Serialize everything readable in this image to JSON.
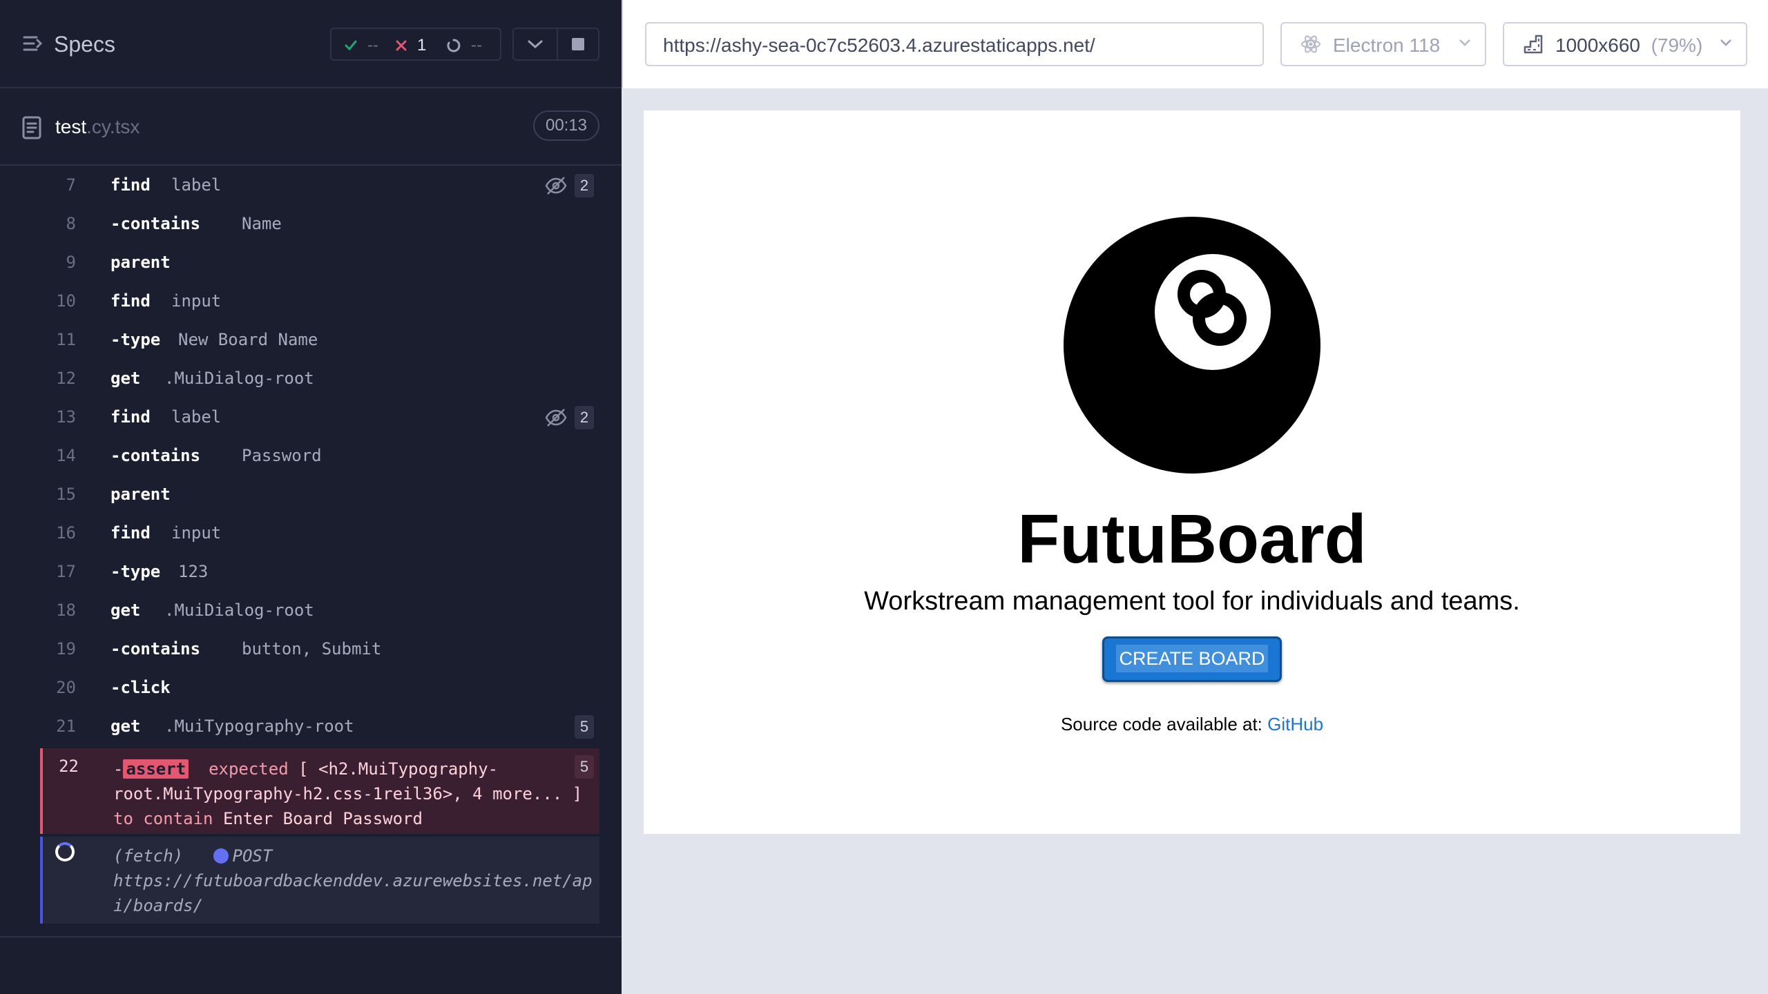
{
  "runner": {
    "title": "Specs",
    "stats": {
      "passed": "--",
      "failed": "1",
      "pending": "--"
    },
    "spec_file": {
      "name": "test",
      "ext": ".cy.tsx",
      "duration": "00:13"
    },
    "commands": [
      {
        "num": "7",
        "name": "find",
        "msg": "label",
        "badge": "2",
        "hidden_icon": true
      },
      {
        "num": "8",
        "name": "-contains",
        "msg": "Name"
      },
      {
        "num": "9",
        "name": "parent",
        "msg": ""
      },
      {
        "num": "10",
        "name": "find",
        "msg": "input"
      },
      {
        "num": "11",
        "name": "-type",
        "msg": "New Board Name"
      },
      {
        "num": "12",
        "name": "get",
        "msg": ".MuiDialog-root"
      },
      {
        "num": "13",
        "name": "find",
        "msg": "label",
        "badge": "2",
        "hidden_icon": true
      },
      {
        "num": "14",
        "name": "-contains",
        "msg": "Password"
      },
      {
        "num": "15",
        "name": "parent",
        "msg": ""
      },
      {
        "num": "16",
        "name": "find",
        "msg": "input"
      },
      {
        "num": "17",
        "name": "-type",
        "msg": "123"
      },
      {
        "num": "18",
        "name": "get",
        "msg": ".MuiDialog-root"
      },
      {
        "num": "19",
        "name": "-contains",
        "msg": "button, Submit"
      },
      {
        "num": "20",
        "name": "-click",
        "msg": ""
      },
      {
        "num": "21",
        "name": "get",
        "msg": ".MuiTypography-root",
        "badge": "5"
      }
    ],
    "failed_command": {
      "num": "22",
      "prefix": "-",
      "name": "assert",
      "expected": "expected",
      "subject": "[ <h2.MuiTypography-root.MuiTypography-h2.css-1reil36>, 4 more... ]",
      "to_contain": "to contain",
      "value": "Enter Board Password",
      "badge": "5"
    },
    "pending_command": {
      "kind": "(fetch)",
      "method": "POST",
      "url": "https://futuboardbackenddev.azurewebsites.net/api/boards/"
    }
  },
  "preview": {
    "url": "https://ashy-sea-0c7c52603.4.azurestaticapps.net/",
    "browser": "Electron 118",
    "viewport": "1000x660",
    "zoom": "(79%)"
  },
  "app": {
    "title": "FutuBoard",
    "subtitle": "Workstream management tool for individuals and teams.",
    "create_button": "CREATE BOARD",
    "source_prefix": "Source code available at:",
    "source_link": "GitHub"
  },
  "colors": {
    "runner_bg": "#1b1e2e",
    "fail_accent": "#e45770",
    "pass_green": "#1fa971",
    "pending_indigo": "#6470f3",
    "primary_blue": "#1976d2"
  },
  "icons": [
    "specs-nav-icon",
    "check-icon",
    "x-icon",
    "spinner-icon",
    "chevron-down-icon",
    "stop-icon",
    "document-icon",
    "eye-slash-icon",
    "electron-icon",
    "viewport-ruler-icon",
    "eight-ball-logo"
  ]
}
